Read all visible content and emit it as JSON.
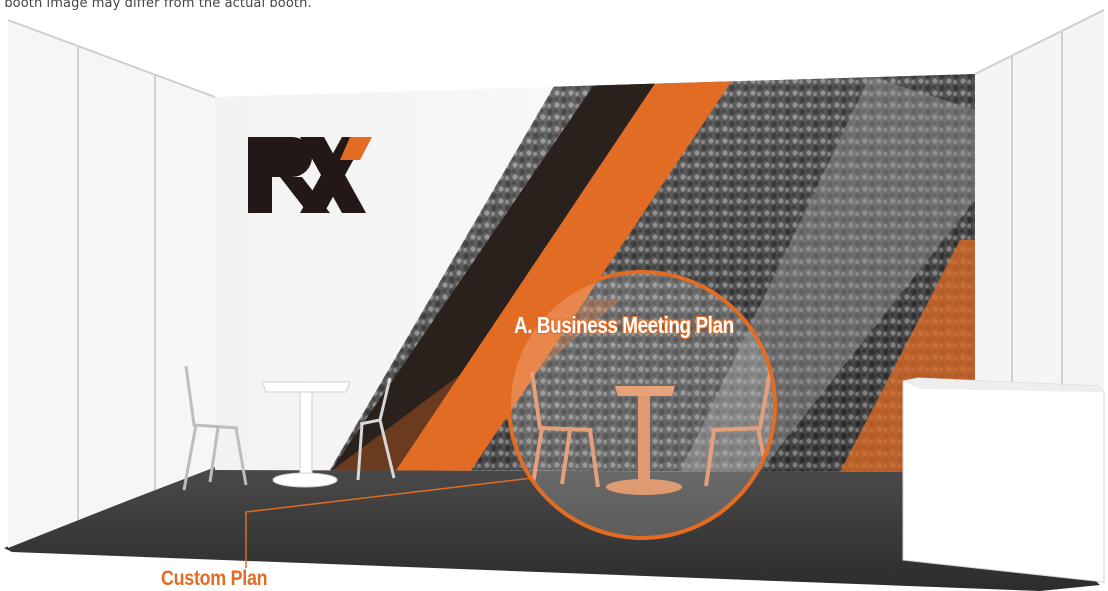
{
  "disclaimer": "e booth image may differ from the actual booth.",
  "booth": {
    "logo_text": "RX",
    "highlight_label": "A. Business Meeting Plan",
    "callout_label": "Custom Plan"
  },
  "colors": {
    "accent": "#e36c24",
    "dark_stripe": "#2b211c",
    "floor": "#3a3a3a",
    "wall": "#ffffff"
  }
}
